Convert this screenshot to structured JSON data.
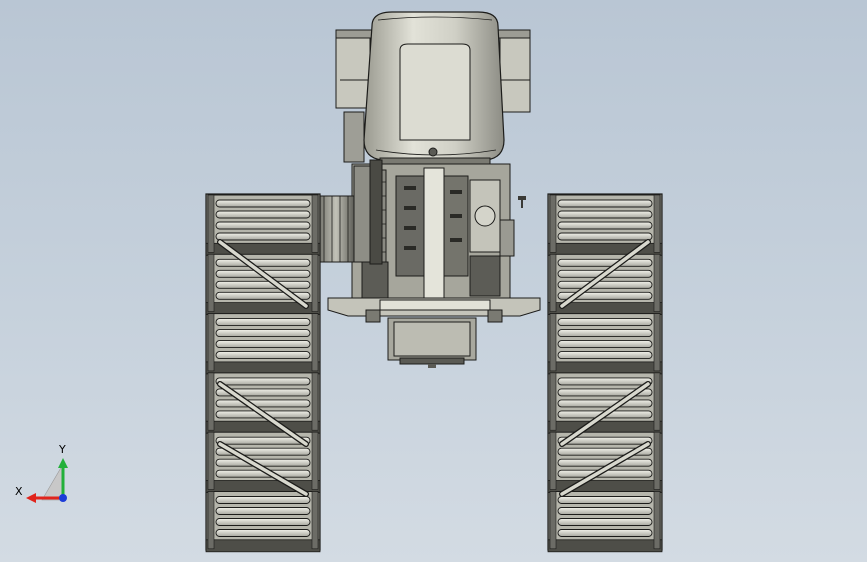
{
  "viewport": {
    "background_top": "#b9c6d4",
    "background_bottom": "#d3dbe3",
    "model_fill": "#b0b0a6",
    "model_light": "#d6d6cc",
    "model_dark": "#3a3a36",
    "edge_color": "#1c1c1a"
  },
  "triad": {
    "x_label": "X",
    "y_label": "Y",
    "x_color": "#e0241c",
    "y_color": "#22b03a",
    "z_color": "#1c3cd8"
  }
}
